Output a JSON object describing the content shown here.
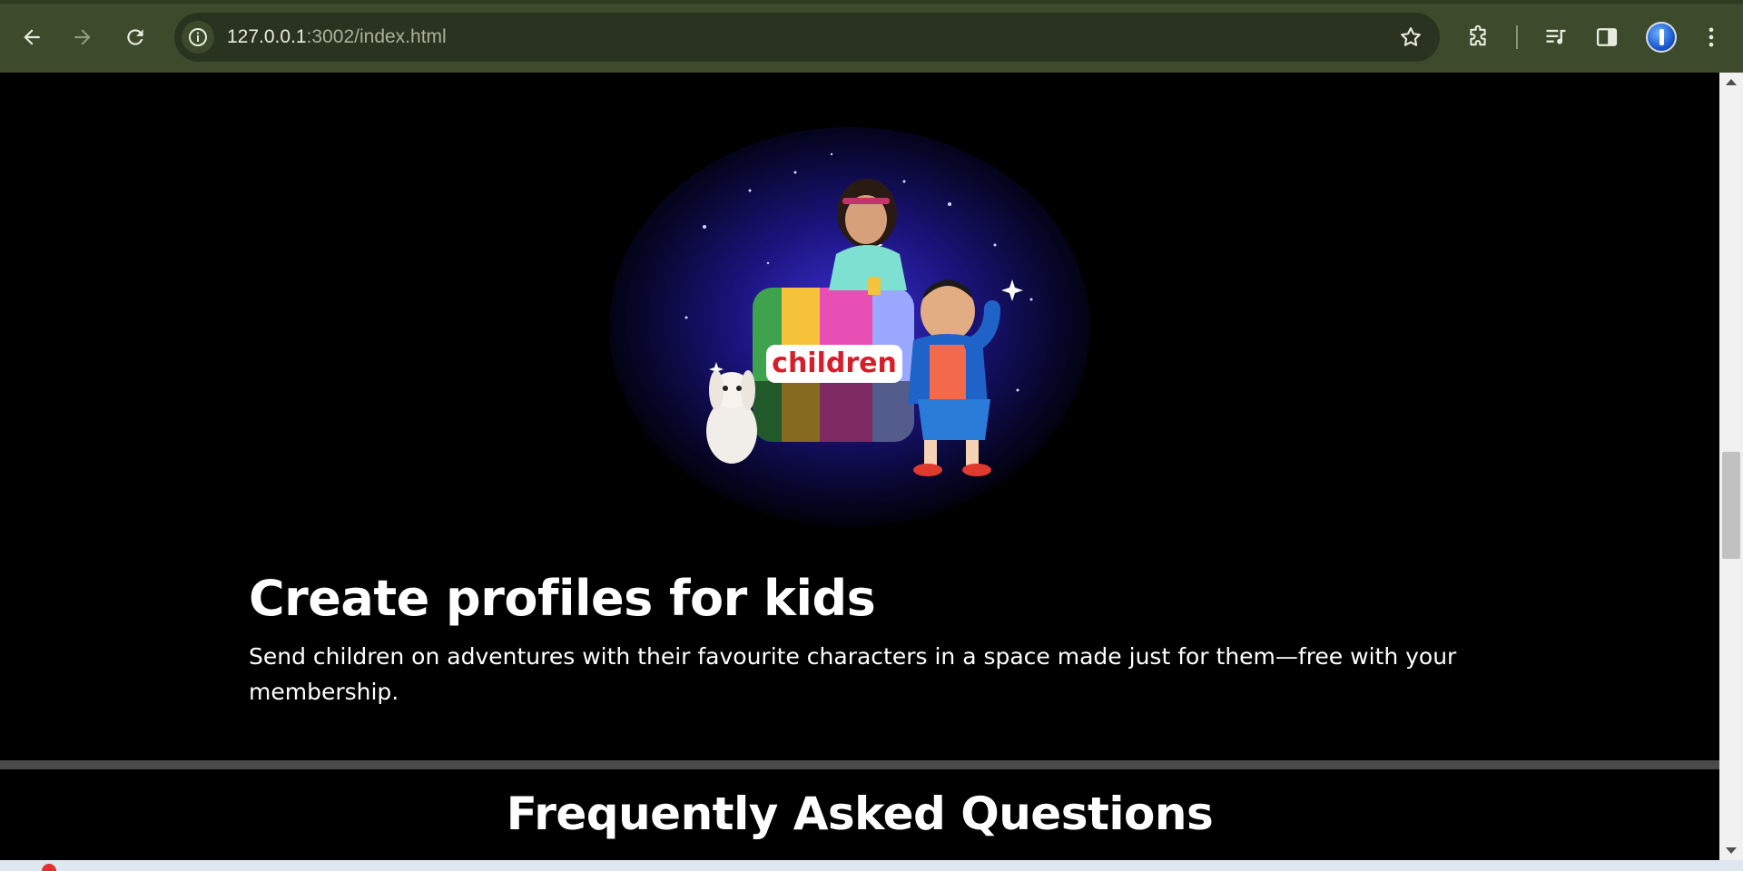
{
  "browser": {
    "url_host": "127.0.0.1",
    "url_path": ":3002/index.html",
    "icons": {
      "back": "arrow-left-icon",
      "forward": "arrow-right-icon",
      "reload": "reload-icon",
      "site_info": "info-icon",
      "bookmark": "star-icon",
      "extensions": "puzzle-icon",
      "media": "media-queue-icon",
      "side_panel": "side-panel-icon",
      "profile": "avatar",
      "menu": "kebab-menu-icon"
    }
  },
  "kids_section": {
    "image_label": "children",
    "title": "Create profiles for kids",
    "description": "Send children on adventures with their favourite characters in a space made just for them—free with your membership."
  },
  "faq": {
    "title": "Frequently Asked Questions"
  },
  "colors": {
    "chrome_bg": "#3d4a2b",
    "omnibox_bg": "#2a3320",
    "page_bg": "#000000",
    "divider": "#4a4a4a",
    "text": "#ffffff"
  }
}
